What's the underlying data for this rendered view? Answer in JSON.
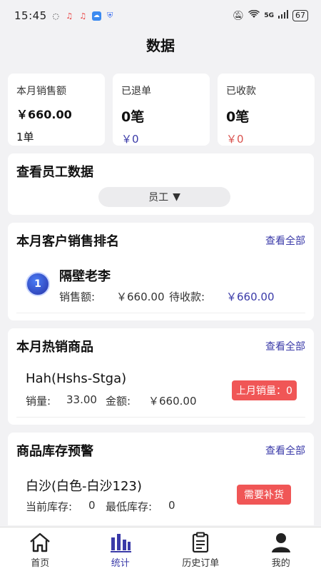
{
  "status_bar": {
    "time": "15:45",
    "network": "5G",
    "battery": "67"
  },
  "page": {
    "title": "数据"
  },
  "stats": [
    {
      "label": "本月销售额",
      "value": "￥660.00",
      "sub": "1单"
    },
    {
      "label": "已退单",
      "value": "0笔",
      "sub": "￥0"
    },
    {
      "label": "已收款",
      "value": "0笔",
      "sub": "￥0"
    }
  ],
  "employee": {
    "title": "查看员工数据",
    "select_value": "员工",
    "select_arrow": "▼"
  },
  "customer_rank": {
    "title": "本月客户销售排名",
    "view_all": "查看全部",
    "items": [
      {
        "rank": "1",
        "name": "隔壁老李",
        "sales_label": "销售额:",
        "sales_value": "￥660.00",
        "pending_label": "待收款:",
        "pending_value": "￥660.00"
      }
    ]
  },
  "hot_products": {
    "title": "本月热销商品",
    "view_all": "查看全部",
    "items": [
      {
        "name": "Hah(Hshs-Stga)",
        "qty_label": "销量:",
        "qty_value": "33.00",
        "amount_label": "金额:",
        "amount_value": "￥660.00",
        "tag": "上月销量：0"
      }
    ]
  },
  "stock_alert": {
    "title": "商品库存预警",
    "view_all": "查看全部",
    "items": [
      {
        "name": "白沙(白色-白沙123)",
        "current_label": "当前库存:",
        "current_value": "0",
        "min_label": "最低库存:",
        "min_value": "0",
        "tag": "需要补货"
      }
    ]
  },
  "bottom_nav": [
    {
      "label": "首页",
      "icon": "home-icon",
      "active": false
    },
    {
      "label": "统计",
      "icon": "bar-chart-icon",
      "active": true
    },
    {
      "label": "历史订单",
      "icon": "clipboard-icon",
      "active": false
    },
    {
      "label": "我的",
      "icon": "user-icon",
      "active": false
    }
  ],
  "colors": {
    "accent": "#3a3aa8",
    "danger": "#f05656",
    "background": "#f2f2f4"
  }
}
